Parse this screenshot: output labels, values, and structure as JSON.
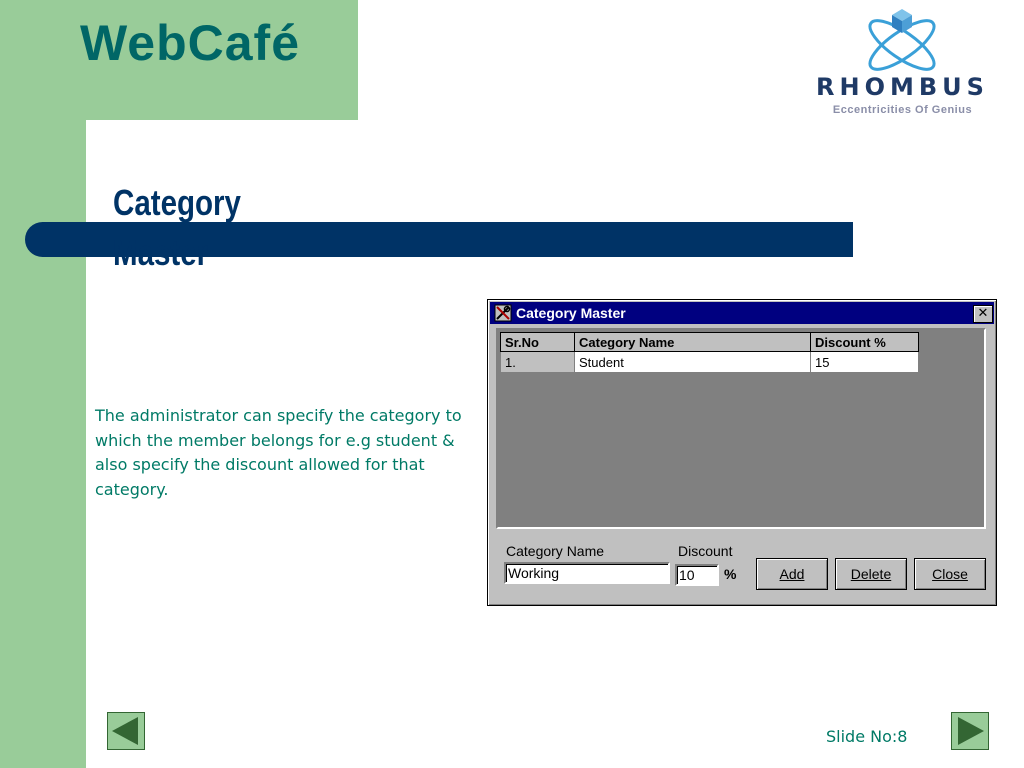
{
  "app_title": "WebCafé",
  "logo": {
    "name": "RHOMBUS",
    "tagline": "Eccentricities Of Genius"
  },
  "slide": {
    "heading": "Category Master",
    "description": "The administrator can specify the category to which the member belongs for e.g student & also specify the discount allowed for that category.",
    "slide_no_label": "Slide No:8"
  },
  "dialog": {
    "title": "Category Master",
    "columns": [
      "Sr.No",
      "Category Name",
      "Discount %"
    ],
    "rows": [
      {
        "sr": "1.",
        "name": "Student",
        "discount": "15"
      }
    ],
    "category_name_label": "Category Name",
    "category_name_value": "Working",
    "discount_label": "Discount",
    "discount_value": "10",
    "percent_symbol": "%",
    "add_label": "Add",
    "delete_label": "Delete",
    "close_label": "Close"
  },
  "colors": {
    "green_band": "#99cc99",
    "title_teal": "#006666",
    "navy": "#003366",
    "body_text": "#007a66"
  },
  "icons": {
    "prev": "triangle-left-icon",
    "next": "triangle-right-icon",
    "dialog": "tools-icon",
    "close": "close-icon"
  }
}
